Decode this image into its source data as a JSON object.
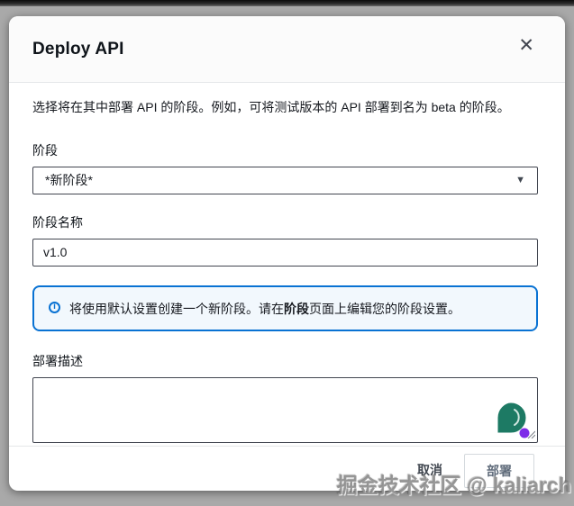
{
  "modal": {
    "title": "Deploy API",
    "close_glyph": "✕",
    "description": "选择将在其中部署 API 的阶段。例如，可将测试版本的 API 部署到名为 beta 的阶段。",
    "fields": {
      "stage": {
        "label": "阶段",
        "selected_value": "*新阶段*",
        "caret_glyph": "▼"
      },
      "stage_name": {
        "label": "阶段名称",
        "value": "v1.0"
      },
      "deploy_description": {
        "label": "部署描述",
        "value": ""
      }
    },
    "alert": {
      "icon_glyph": "i",
      "text_before": "将使用默认设置创建一个新阶段。请在",
      "text_bold": "阶段",
      "text_after": "页面上编辑您的阶段设置。"
    },
    "footer": {
      "cancel_label": "取消",
      "deploy_label": "部署"
    }
  },
  "watermark": "掘金技术社区 @ kaliarch",
  "colors": {
    "accent_blue": "#0972d3",
    "alert_background": "#f2f8fd",
    "input_border": "#424650",
    "chat_bubble_green": "#1d7a64",
    "chat_dot_purple": "#7d2ae8"
  }
}
